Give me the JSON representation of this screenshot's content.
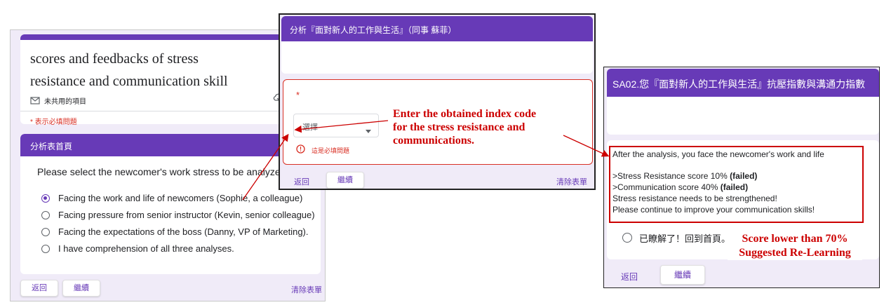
{
  "left_form": {
    "title_line1": "scores and feedbacks of stress",
    "title_line2": "resistance and communication skill",
    "unshared_label": "未共用的項目",
    "required_note": "* 表示必填問題",
    "section_title": "分析表首頁",
    "question": "Please select the newcomer's work stress to be analyzed",
    "options": [
      "Facing the work and life of newcomers (Sophie, a colleague)",
      "Facing pressure from senior instructor (Kevin, senior colleague)",
      "Facing the expectations of the boss (Danny, VP of Marketing).",
      "I have comprehension of all three analyses."
    ],
    "back_label": "返回",
    "next_label": "繼續",
    "clear_label": "清除表單"
  },
  "middle_form": {
    "header": "分析『面對新人的工作與生活』（同事 蘇菲）",
    "asterisk": "*",
    "select_value": "選擇",
    "error_text": "這是必填問題",
    "back_label": "返回",
    "next_label": "繼續",
    "clear_label": "清除表單"
  },
  "right_form": {
    "header": "SA02.您『面對新人的工作與生活』抗壓指數與溝通力指數",
    "line1": "After the analysis, you face the newcomer's work and life",
    "stress_text": ">Stress Resistance score 10%",
    "comm_text": ">Communication score 40%",
    "failed": "(failed)",
    "line4": "Stress resistance needs to be strengthened!",
    "line5": "Please continue to improve your communication skills!",
    "option": "已瞭解了！回到首頁。",
    "back_label": "返回",
    "next_label": "繼續"
  },
  "annotations": {
    "middle_line1": "Enter the obtained index code",
    "middle_line2": "for the stress resistance and",
    "middle_line3": "communications.",
    "right_line1": "Score lower than 70%",
    "right_line2": "Suggested Re-Learning"
  }
}
